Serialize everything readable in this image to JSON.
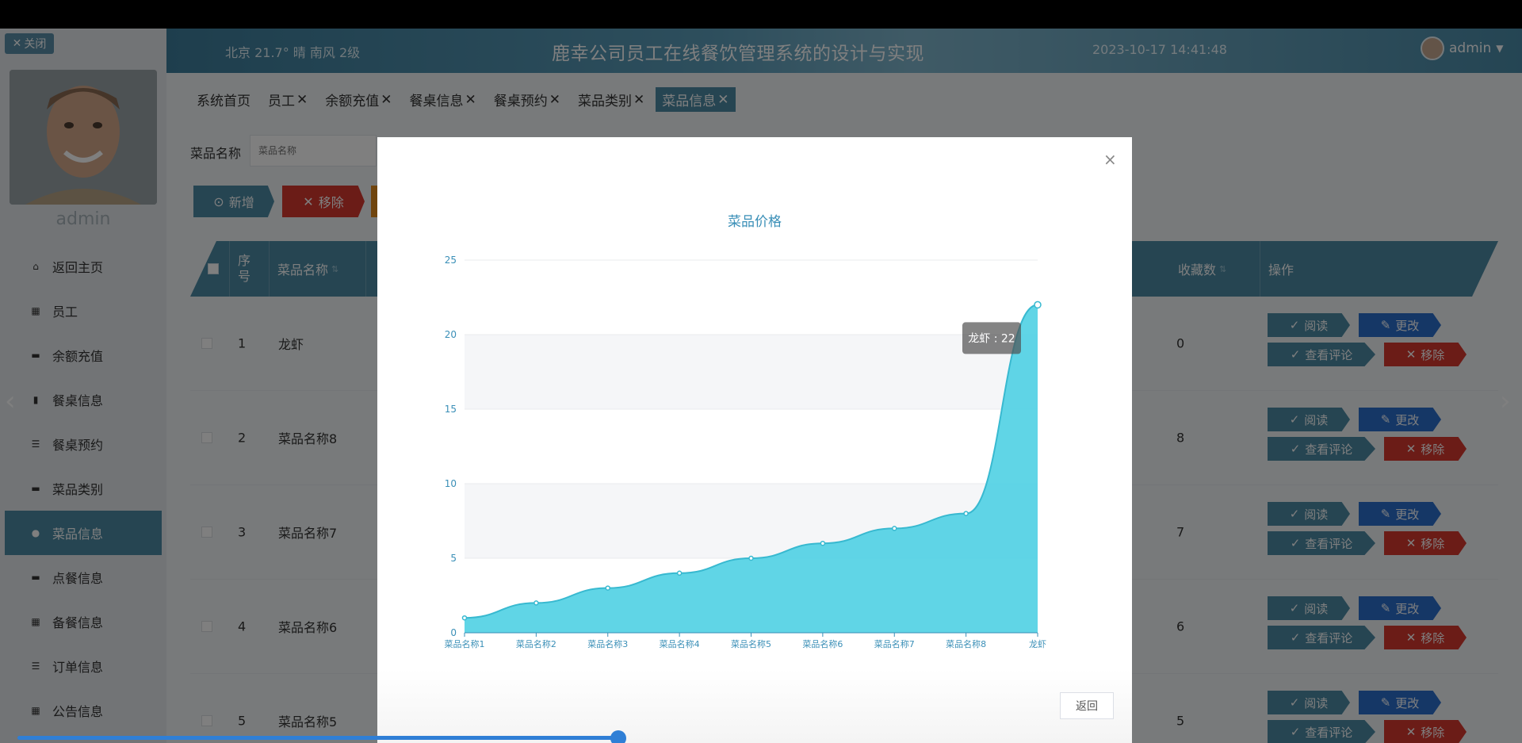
{
  "sidebar": {
    "close_label": "关闭",
    "username": "admin",
    "menu": [
      {
        "icon": "home-icon",
        "glyph": "⌂",
        "label": "返回主页"
      },
      {
        "icon": "grid-icon",
        "glyph": "▦",
        "label": "员工"
      },
      {
        "icon": "chat-icon",
        "glyph": "▬",
        "label": "余额充值"
      },
      {
        "icon": "clipboard-icon",
        "glyph": "▮",
        "label": "餐桌信息"
      },
      {
        "icon": "list-icon",
        "glyph": "☰",
        "label": "餐桌预约"
      },
      {
        "icon": "monitor-icon",
        "glyph": "▬",
        "label": "菜品类别"
      },
      {
        "icon": "pin-icon",
        "glyph": "●",
        "label": "菜品信息"
      },
      {
        "icon": "wallet-icon",
        "glyph": "▬",
        "label": "点餐信息"
      },
      {
        "icon": "grid-icon",
        "glyph": "▦",
        "label": "备餐信息"
      },
      {
        "icon": "list-icon",
        "glyph": "☰",
        "label": "订单信息"
      },
      {
        "icon": "grid-icon",
        "glyph": "▦",
        "label": "公告信息"
      }
    ],
    "active_index": 6
  },
  "header": {
    "weather": "北京 21.7° 晴 南风 2级",
    "title": "鹿幸公司员工在线餐饮管理系统的设计与实现",
    "datetime": "2023-10-17 14:41:48",
    "user": "admin"
  },
  "tabs": [
    {
      "label": "系统首页",
      "closable": false
    },
    {
      "label": "员工",
      "closable": true
    },
    {
      "label": "余额充值",
      "closable": true
    },
    {
      "label": "餐桌信息",
      "closable": true
    },
    {
      "label": "餐桌预约",
      "closable": true
    },
    {
      "label": "菜品类别",
      "closable": true
    },
    {
      "label": "菜品信息",
      "closable": true
    }
  ],
  "search": {
    "label": "菜品名称",
    "placeholder": "菜品名称"
  },
  "toolbar": {
    "add_label": "新增",
    "remove_label": "移除"
  },
  "table": {
    "headers": {
      "index": "序号",
      "name": "菜品名称",
      "favorites": "收藏数",
      "actions": "操作"
    },
    "rows": [
      {
        "index": "1",
        "name": "龙虾",
        "favorites": "0"
      },
      {
        "index": "2",
        "name": "菜品名称8",
        "favorites": "8"
      },
      {
        "index": "3",
        "name": "菜品名称7",
        "favorites": "7"
      },
      {
        "index": "4",
        "name": "菜品名称6",
        "favorites": "6"
      },
      {
        "index": "5",
        "name": "菜品名称5",
        "favorites": "5"
      }
    ],
    "actions": {
      "read": "阅读",
      "edit": "更改",
      "comment": "查看评论",
      "delete": "移除"
    }
  },
  "modal": {
    "back_label": "返回",
    "tooltip": {
      "name": "龙虾",
      "value": "22"
    }
  },
  "chart_data": {
    "type": "area",
    "title": "菜品价格",
    "categories": [
      "菜品名称1",
      "菜品名称2",
      "菜品名称3",
      "菜品名称4",
      "菜品名称5",
      "菜品名称6",
      "菜品名称7",
      "菜品名称8",
      "龙虾"
    ],
    "values": [
      1,
      2,
      3,
      4,
      5,
      6,
      7,
      8,
      22
    ],
    "ylim": [
      0,
      25
    ],
    "yticks": [
      0,
      5,
      10,
      15,
      20,
      25
    ],
    "grid": true,
    "color": "#4fd0e3"
  },
  "colors": {
    "primary": "#4c8aa4",
    "danger": "#d6382f",
    "edit": "#2b6fcd"
  }
}
